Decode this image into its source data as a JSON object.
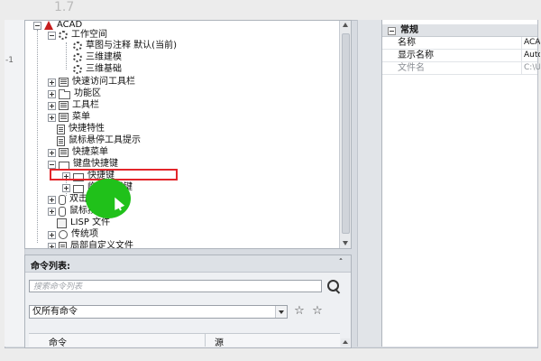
{
  "background_ghost": {
    "top": "1.7",
    "left": "-1"
  },
  "tree": {
    "root": "ACAD",
    "items": [
      {
        "label": "工作空间",
        "icon": "gear-icon"
      },
      {
        "label": "草图与注释 默认(当前)",
        "icon": "gear-icon"
      },
      {
        "label": "三维建模",
        "icon": "gear-icon"
      },
      {
        "label": "三维基础",
        "icon": "gear-icon"
      },
      {
        "label": "快速访问工具栏",
        "icon": "toolbar-icon"
      },
      {
        "label": "功能区",
        "icon": "folder-icon"
      },
      {
        "label": "工具栏",
        "icon": "toolbar-icon"
      },
      {
        "label": "菜单",
        "icon": "menu-icon"
      },
      {
        "label": "快捷特性",
        "icon": "document-icon"
      },
      {
        "label": "鼠标悬停工具提示",
        "icon": "document-icon"
      },
      {
        "label": "快捷菜单",
        "icon": "menu-icon"
      },
      {
        "label": "键盘快捷键",
        "icon": "keyboard-icon"
      },
      {
        "label": "快捷键",
        "icon": "keyboard-icon"
      },
      {
        "label": "临时替代键",
        "icon": "keyboard-icon"
      },
      {
        "label": "双击动作",
        "icon": "mouse-icon"
      },
      {
        "label": "鼠标按钮",
        "icon": "mouse-icon"
      },
      {
        "label": "LISP 文件",
        "icon": "lisp-icon"
      },
      {
        "label": "传统项",
        "icon": "clock-icon"
      },
      {
        "label": "局部自定义文件",
        "icon": "document-icon"
      }
    ]
  },
  "command_list": {
    "title": "命令列表:",
    "collapse_glyph": "ˆ",
    "search_placeholder": "搜索命令列表",
    "filter_value": "仅所有命令",
    "columns": [
      "命令",
      "源"
    ]
  },
  "properties": {
    "group": "常规",
    "rows": [
      {
        "key": "名称",
        "value": "ACAD"
      },
      {
        "key": "显示名称",
        "value": "AutoCAD"
      },
      {
        "key": "文件名",
        "value": "C:\\U"
      }
    ]
  },
  "colors": {
    "highlight_box": "#e3262b",
    "cursor_marker": "#20c11a",
    "acad_icon": "#c61e1e"
  }
}
